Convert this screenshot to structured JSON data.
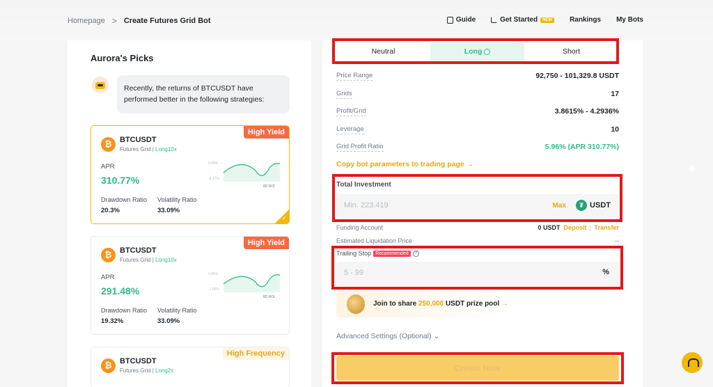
{
  "breadcrumb": {
    "home": "Homepage",
    "separator": ">",
    "current": "Create Futures Grid Bot"
  },
  "topnav": {
    "guide": "Guide",
    "get_started": "Get Started",
    "new_badge": "NEW",
    "rankings": "Rankings",
    "my_bots": "My Bots"
  },
  "picks": {
    "title": "Aurora's Picks",
    "message": "Recently, the returns of BTCUSDT have performed better in the following strategies:",
    "cards": [
      {
        "symbol": "BTCUSDT",
        "type": "Futures Grid",
        "sep": "|",
        "leverage": "Long10x",
        "badge": "High Yield",
        "apr_label": "APR",
        "apr": "310.77%",
        "dd_label": "Drawdown Ratio",
        "dd": "20.3%",
        "vr_label": "Volatility Ratio",
        "vr": "33.09%",
        "spark_hi": "9.45%",
        "spark_lo": "-8.27%",
        "roi": "8D ROI",
        "selected": true
      },
      {
        "symbol": "BTCUSDT",
        "type": "Futures Grid",
        "sep": "|",
        "leverage": "Long10x",
        "badge": "High Yield",
        "apr_label": "APR",
        "apr": "291.48%",
        "dd_label": "Drawdown Ratio",
        "dd": "19.32%",
        "vr_label": "Volatility Ratio",
        "vr": "33.09%",
        "spark_hi": "9.85%",
        "spark_lo": "-7.66%",
        "roi": "8D ROI",
        "selected": false
      },
      {
        "symbol": "BTCUSDT",
        "type": "Futures Grid",
        "sep": "|",
        "leverage": "Long2x",
        "badge": "High Frequency"
      }
    ]
  },
  "tabs": {
    "neutral": "Neutral",
    "long": "Long",
    "short": "Short",
    "active": "Long"
  },
  "params": {
    "price_range_label": "Price Range",
    "price_range": "92,750 - 101,329.8 USDT",
    "grids_label": "Grids",
    "grids": "17",
    "profit_label": "Profit/Grid",
    "profit": "3.8615% - 4.2936%",
    "leverage_label": "Leverage",
    "leverage": "10",
    "gpr_label": "Grid Profit Ratio",
    "gpr": "5.96% (APR 310.77%)",
    "copy_link": "Copy bot parameters to trading page →"
  },
  "investment": {
    "label": "Total Investment",
    "placeholder": "Min. 223.419",
    "max": "Max",
    "currency": "USDT"
  },
  "funding": {
    "label": "Funding Account",
    "balance": "0 USDT",
    "deposit": "Deposit",
    "transfer": "Transfer"
  },
  "liquidation": {
    "label": "Estimated Liquidation Price",
    "value": "--"
  },
  "trailing": {
    "label": "Trailing Stop",
    "badge": "Recommended",
    "placeholder": "5 - 99",
    "unit": "%"
  },
  "promo": {
    "prefix": "Join to share ",
    "amount": "250,000",
    "suffix": " USDT prize pool",
    "arrow": "→"
  },
  "advanced": "Advanced Settings (Optional) ⌄",
  "create_button": "Create Now",
  "colors": {
    "accent": "#f0b90b",
    "green": "#2ebd85",
    "red_highlight": "#e31818"
  }
}
